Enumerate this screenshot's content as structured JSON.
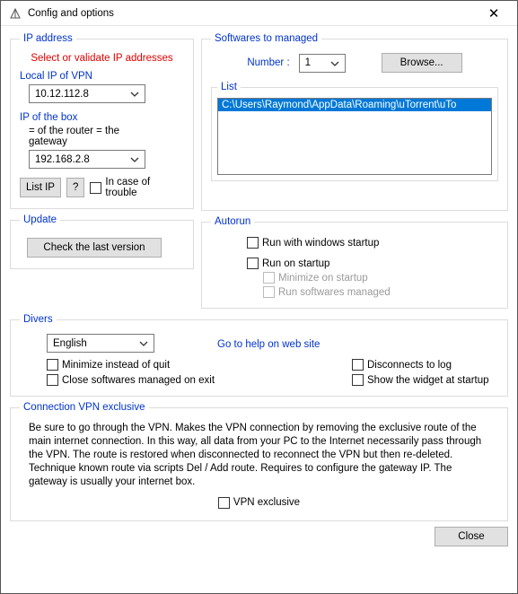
{
  "window": {
    "title": "Config and options"
  },
  "ip": {
    "legend": "IP address",
    "caption": "Select or validate IP addresses",
    "local_label": "Local IP of VPN",
    "local_value": "10.12.112.8",
    "box_label": "IP of the box",
    "box_hint": "= of the router = the gateway",
    "box_value": "192.168.2.8",
    "list_ip_btn": "List IP",
    "q_btn": "?",
    "trouble_label": "In case of trouble"
  },
  "update": {
    "legend": "Update",
    "check_btn": "Check the last version"
  },
  "software": {
    "legend": "Softwares to managed",
    "number_label": "Number :",
    "number_value": "1",
    "browse_btn": "Browse...",
    "list_legend": "List",
    "list_item": "C:\\Users\\Raymond\\AppData\\Roaming\\uTorrent\\uTo"
  },
  "autorun": {
    "legend": "Autorun",
    "run_win_startup": "Run with windows startup",
    "run_startup": "Run on startup",
    "minimize_startup": "Minimize on startup",
    "run_soft_managed": "Run softwares managed"
  },
  "divers": {
    "legend": "Divers",
    "language": "English",
    "goto_help": "Go to help on web site",
    "minimize_quit": "Minimize instead of quit",
    "close_soft_exit": "Close softwares managed on exit",
    "disconnects_log": "Disconnects to log",
    "show_widget": "Show the widget at startup"
  },
  "vpn": {
    "legend": "Connection VPN exclusive",
    "text": "Be sure to go through the VPN. Makes the VPN connection by removing the exclusive route of the main internet connection. In this way, all data from your PC to the Internet necessarily pass through the VPN. The route is restored when disconnected to reconnect the VPN but then re-deleted. Technique known route via scripts Del / Add route. Requires to configure the gateway IP. The gateway is usually your internet box.",
    "vpn_exclusive": "VPN exclusive"
  },
  "footer": {
    "close_btn": "Close"
  }
}
